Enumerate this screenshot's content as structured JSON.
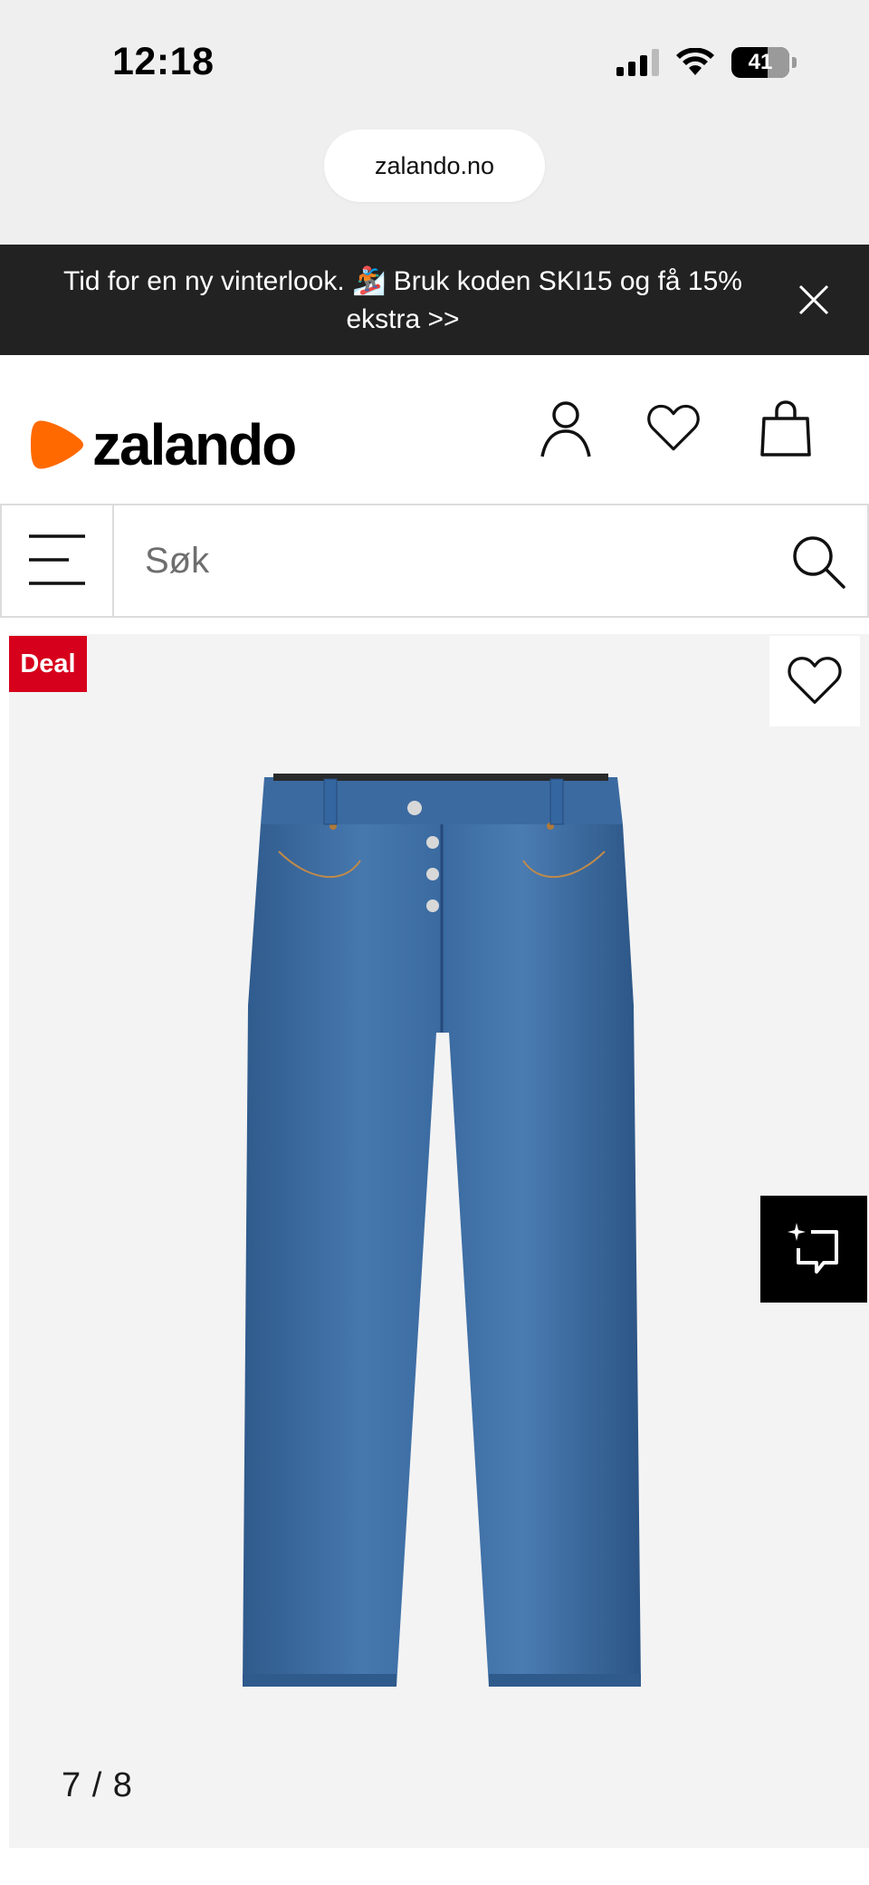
{
  "status_bar": {
    "time": "12:18",
    "battery_level": "41",
    "icons": [
      "signal-icon",
      "wifi-icon",
      "battery-icon"
    ]
  },
  "browser": {
    "url": "zalando.no"
  },
  "promo": {
    "text": "Tid for en ny vinterlook. 🏂 Bruk koden SKI15 og få 15% ekstra >>",
    "close_icon": "close-icon"
  },
  "header": {
    "logo_text": "zalando",
    "brand_color": "#ff6900",
    "icons": [
      "account-icon",
      "wishlist-icon",
      "bag-icon"
    ]
  },
  "search": {
    "placeholder": "Søk",
    "menu_icon": "menu-icon",
    "search_icon": "search-icon"
  },
  "gallery": {
    "badge": "Deal",
    "badge_color": "#d7001c",
    "counter": "7 / 8",
    "current_image": 7,
    "total_images": 8,
    "image_subject": "blue denim jeans",
    "wishlist_icon": "heart-icon",
    "style_icon": "sparkle-chat-icon"
  }
}
